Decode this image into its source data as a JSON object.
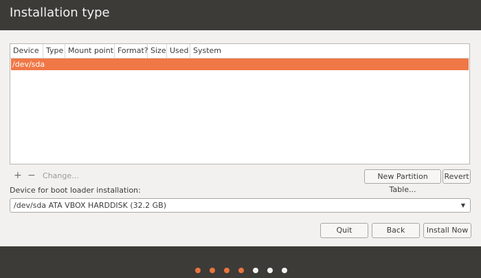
{
  "header": {
    "title": "Installation type"
  },
  "partition_table": {
    "columns": [
      "Device",
      "Type",
      "Mount point",
      "Format?",
      "Size",
      "Used",
      "System"
    ],
    "rows": [
      {
        "device": "/dev/sda",
        "selected": true
      }
    ]
  },
  "toolbar": {
    "add_label": "+",
    "remove_label": "−",
    "change_label": "Change...",
    "new_partition_table_label": "New Partition Table...",
    "revert_label": "Revert"
  },
  "boot_loader": {
    "label": "Device for boot loader installation:",
    "selected_value": "/dev/sda ATA VBOX HARDDISK (32.2 GB)"
  },
  "actions": {
    "quit_label": "Quit",
    "back_label": "Back",
    "install_now_label": "Install Now"
  },
  "progress": {
    "total_steps": 7,
    "completed_steps": 4,
    "active_color": "#e9743f",
    "inactive_color": "#f2f1f0"
  },
  "colors": {
    "accent": "#f07746",
    "header_bg": "#3c3b37"
  }
}
